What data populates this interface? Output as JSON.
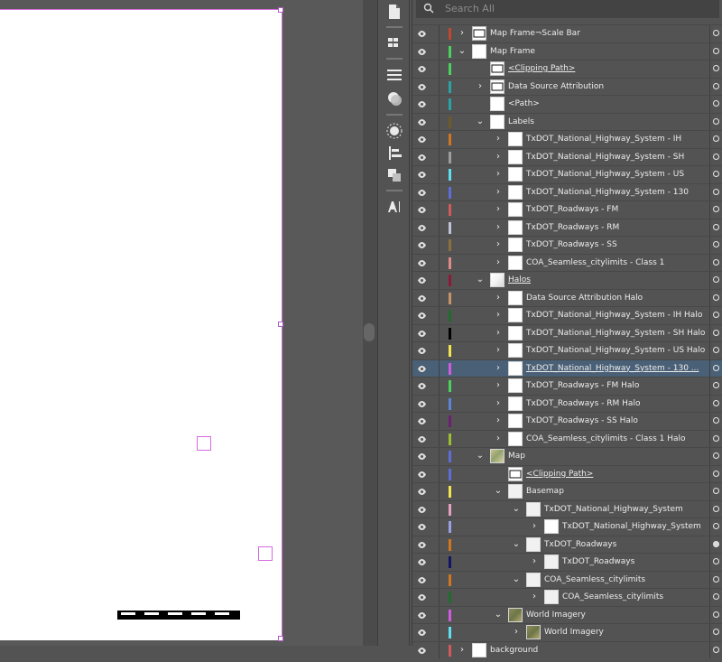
{
  "panel": {
    "search_placeholder": "Search All",
    "layers": [
      {
        "label": "Map Frame¬Scale Bar",
        "color": "#c2472f",
        "indent": 0,
        "twisty": "right",
        "thumb": "frame",
        "target": "empty"
      },
      {
        "label": "Map Frame",
        "color": "#4bd25e",
        "indent": 0,
        "twisty": "down",
        "thumb": "white",
        "target": "empty"
      },
      {
        "label": "<Clipping Path>",
        "color": "#4bd25e",
        "indent": 1,
        "twisty": "",
        "thumb": "frame",
        "underline": true,
        "target": "empty"
      },
      {
        "label": "Data Source Attribution",
        "color": "#2aa3a8",
        "indent": 1,
        "twisty": "right",
        "thumb": "frame",
        "target": "empty"
      },
      {
        "label": "<Path>",
        "color": "#2aa3a8",
        "indent": 1,
        "twisty": "",
        "thumb": "white",
        "target": "empty"
      },
      {
        "label": "Labels",
        "color": "#6e5a28",
        "indent": 1,
        "twisty": "down",
        "thumb": "white",
        "target": "empty"
      },
      {
        "label": "TxDOT_National_Highway_System - IH",
        "color": "#d1761e",
        "indent": 2,
        "twisty": "right",
        "thumb": "white",
        "target": "empty"
      },
      {
        "label": "TxDOT_National_Highway_System - SH",
        "color": "#9e9e9e",
        "indent": 2,
        "twisty": "right",
        "thumb": "white",
        "target": "empty"
      },
      {
        "label": "TxDOT_National_Highway_System - US",
        "color": "#5ee0f0",
        "indent": 2,
        "twisty": "right",
        "thumb": "white",
        "target": "empty"
      },
      {
        "label": "TxDOT_National_Highway_System - 130",
        "color": "#5f6dd8",
        "indent": 2,
        "twisty": "right",
        "thumb": "white",
        "target": "empty"
      },
      {
        "label": "TxDOT_Roadways - FM",
        "color": "#d35a5a",
        "indent": 2,
        "twisty": "right",
        "thumb": "white",
        "target": "empty"
      },
      {
        "label": "TxDOT_Roadways - RM",
        "color": "#c2c2d6",
        "indent": 2,
        "twisty": "right",
        "thumb": "white",
        "target": "empty"
      },
      {
        "label": "TxDOT_Roadways - SS",
        "color": "#8b6f3d",
        "indent": 2,
        "twisty": "right",
        "thumb": "white",
        "target": "empty"
      },
      {
        "label": "COA_Seamless_citylimits - Class 1",
        "color": "#e08a8a",
        "indent": 2,
        "twisty": "right",
        "thumb": "white",
        "target": "empty"
      },
      {
        "label": "Halos",
        "color": "#8e1a3a",
        "indent": 1,
        "twisty": "down",
        "thumb": "halo",
        "underline": true,
        "target": "empty"
      },
      {
        "label": "Data Source Attribution Halo",
        "color": "#c7946a",
        "indent": 2,
        "twisty": "right",
        "thumb": "white",
        "target": "empty"
      },
      {
        "label": "TxDOT_National_Highway_System - IH Halo",
        "color": "#1e6d2b",
        "indent": 2,
        "twisty": "right",
        "thumb": "white",
        "target": "empty"
      },
      {
        "label": "TxDOT_National_Highway_System - SH Halo",
        "color": "#000000",
        "indent": 2,
        "twisty": "right",
        "thumb": "white",
        "target": "empty"
      },
      {
        "label": "TxDOT_National_Highway_System - US Halo",
        "color": "#f1e64e",
        "indent": 2,
        "twisty": "right",
        "thumb": "white",
        "target": "empty"
      },
      {
        "label": "TxDOT_National_Highway_System - 130 ...",
        "color": "#d15be0",
        "indent": 2,
        "twisty": "right",
        "thumb": "white",
        "selected": true,
        "underline": true,
        "target": "empty"
      },
      {
        "label": "TxDOT_Roadways - FM Halo",
        "color": "#4bd25e",
        "indent": 2,
        "twisty": "right",
        "thumb": "white",
        "target": "empty"
      },
      {
        "label": "TxDOT_Roadways - RM Halo",
        "color": "#5b86d6",
        "indent": 2,
        "twisty": "right",
        "thumb": "white",
        "target": "empty"
      },
      {
        "label": "TxDOT_Roadways - SS Halo",
        "color": "#6d1f74",
        "indent": 2,
        "twisty": "right",
        "thumb": "white",
        "target": "empty"
      },
      {
        "label": "COA_Seamless_citylimits - Class 1 Halo",
        "color": "#9bbf2f",
        "indent": 2,
        "twisty": "right",
        "thumb": "white",
        "target": "empty"
      },
      {
        "label": "Map",
        "color": "#5f6dd8",
        "indent": 1,
        "twisty": "down",
        "thumb": "map",
        "target": "empty"
      },
      {
        "label": "<Clipping Path>",
        "color": "#5f6dd8",
        "indent": 2,
        "twisty": "",
        "thumb": "frame",
        "underline": true,
        "target": "empty"
      },
      {
        "label": "Basemap",
        "color": "#f1e64e",
        "indent": 2,
        "twisty": "down",
        "thumb": "light",
        "target": "empty"
      },
      {
        "label": "TxDOT_National_Highway_System",
        "color": "#e8a0c2",
        "indent": 3,
        "twisty": "down",
        "thumb": "light",
        "target": "empty"
      },
      {
        "label": "TxDOT_National_Highway_System",
        "color": "#9aa0e6",
        "indent": 4,
        "twisty": "right",
        "thumb": "white",
        "target": "empty"
      },
      {
        "label": "TxDOT_Roadways",
        "color": "#d1761e",
        "indent": 3,
        "twisty": "down",
        "thumb": "light",
        "target": "filled"
      },
      {
        "label": "TxDOT_Roadways",
        "color": "#121466",
        "indent": 4,
        "twisty": "right",
        "thumb": "light",
        "target": "empty"
      },
      {
        "label": "COA_Seamless_citylimits",
        "color": "#d1761e",
        "indent": 3,
        "twisty": "down",
        "thumb": "light",
        "target": "empty"
      },
      {
        "label": "COA_Seamless_citylimits",
        "color": "#1e6d2b",
        "indent": 4,
        "twisty": "right",
        "thumb": "light",
        "target": "empty"
      },
      {
        "label": "World Imagery",
        "color": "#d15be0",
        "indent": 2,
        "twisty": "down",
        "thumb": "imagery",
        "target": "empty"
      },
      {
        "label": "World Imagery",
        "color": "#5ee0f0",
        "indent": 3,
        "twisty": "right",
        "thumb": "imagery",
        "target": "empty"
      },
      {
        "label": "background",
        "color": "#d35a5a",
        "indent": 0,
        "twisty": "right",
        "thumb": "white",
        "target": "empty"
      }
    ]
  },
  "tools": [
    "page-icon",
    "swatches-icon",
    "stroke-icon",
    "gradient-icon",
    "effects-icon",
    "align-icon",
    "pathfinder-icon",
    "character-icon"
  ],
  "icon_colors": {
    "eye": "#dfdfdf",
    "page_border": "#d46bd8",
    "selected_row": "#4a6076"
  }
}
